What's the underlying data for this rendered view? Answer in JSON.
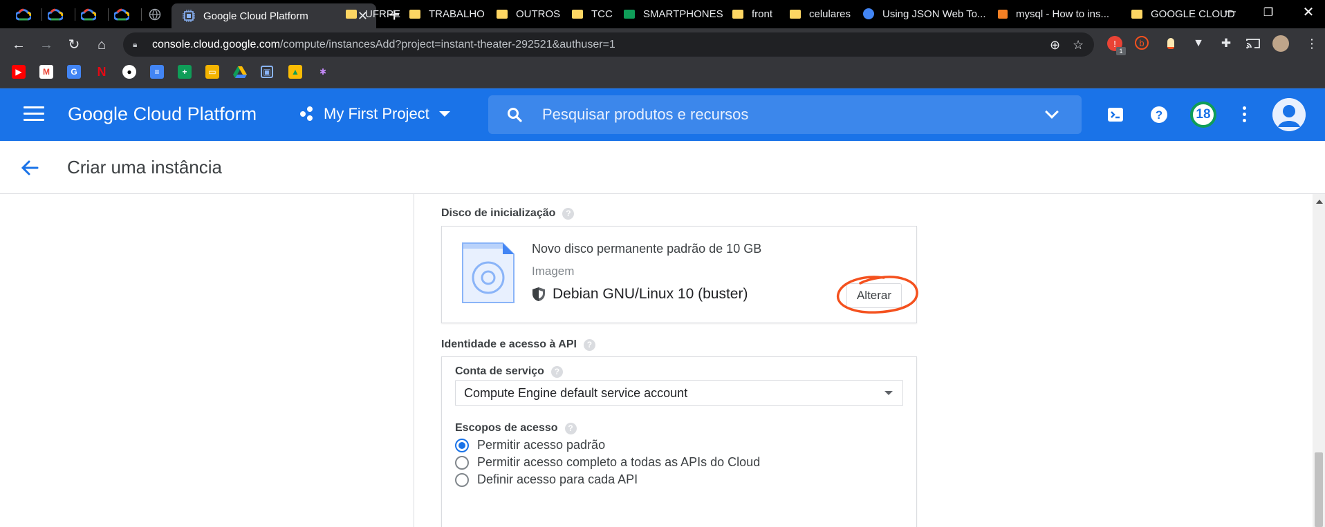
{
  "browser": {
    "active_tab_title": "Google Cloud Platform",
    "url_host": "console.cloud.google.com",
    "url_path": "/compute/instancesAdd?project=instant-theater-292521&authuser=1",
    "extension_badge": "1",
    "bookmarks": [
      "UFRPE",
      "TRABALHO",
      "OUTROS",
      "TCC",
      "SMARTPHONES",
      "front",
      "celulares",
      "Using JSON Web To...",
      "mysql - How to ins...",
      "GOOGLE CLOUD"
    ]
  },
  "header": {
    "brand": "Google Cloud Platform",
    "project_name": "My First Project",
    "search_placeholder": "Pesquisar produtos e recursos",
    "notifications_count": "18"
  },
  "page": {
    "title": "Criar uma instância"
  },
  "boot_disk": {
    "label": "Disco de inicialização",
    "title": "Novo disco permanente padrão de 10 GB",
    "image_label": "Imagem",
    "image_name": "Debian GNU/Linux 10 (buster)",
    "change_button": "Alterar"
  },
  "identity": {
    "label": "Identidade e acesso à API",
    "service_account_label": "Conta de serviço",
    "service_account_value": "Compute Engine default service account",
    "scopes_label": "Escopos de acesso",
    "scopes": [
      {
        "label": "Permitir acesso padrão",
        "checked": true
      },
      {
        "label": "Permitir acesso completo a todas as APIs do Cloud",
        "checked": false
      },
      {
        "label": "Definir acesso para cada API",
        "checked": false
      }
    ]
  },
  "colors": {
    "brand_blue": "#1a73e8",
    "highlight": "#f4511e"
  }
}
